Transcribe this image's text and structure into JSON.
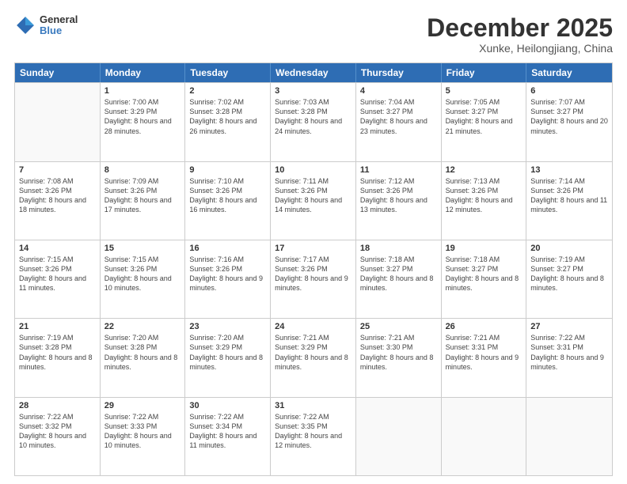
{
  "header": {
    "logo_general": "General",
    "logo_blue": "Blue",
    "month": "December 2025",
    "location": "Xunke, Heilongjiang, China"
  },
  "days_of_week": [
    "Sunday",
    "Monday",
    "Tuesday",
    "Wednesday",
    "Thursday",
    "Friday",
    "Saturday"
  ],
  "weeks": [
    [
      {
        "day": null
      },
      {
        "day": 1,
        "sunrise": "7:00 AM",
        "sunset": "3:29 PM",
        "daylight": "8 hours and 28 minutes."
      },
      {
        "day": 2,
        "sunrise": "7:02 AM",
        "sunset": "3:28 PM",
        "daylight": "8 hours and 26 minutes."
      },
      {
        "day": 3,
        "sunrise": "7:03 AM",
        "sunset": "3:28 PM",
        "daylight": "8 hours and 24 minutes."
      },
      {
        "day": 4,
        "sunrise": "7:04 AM",
        "sunset": "3:27 PM",
        "daylight": "8 hours and 23 minutes."
      },
      {
        "day": 5,
        "sunrise": "7:05 AM",
        "sunset": "3:27 PM",
        "daylight": "8 hours and 21 minutes."
      },
      {
        "day": 6,
        "sunrise": "7:07 AM",
        "sunset": "3:27 PM",
        "daylight": "8 hours and 20 minutes."
      }
    ],
    [
      {
        "day": 7,
        "sunrise": "7:08 AM",
        "sunset": "3:26 PM",
        "daylight": "8 hours and 18 minutes."
      },
      {
        "day": 8,
        "sunrise": "7:09 AM",
        "sunset": "3:26 PM",
        "daylight": "8 hours and 17 minutes."
      },
      {
        "day": 9,
        "sunrise": "7:10 AM",
        "sunset": "3:26 PM",
        "daylight": "8 hours and 16 minutes."
      },
      {
        "day": 10,
        "sunrise": "7:11 AM",
        "sunset": "3:26 PM",
        "daylight": "8 hours and 14 minutes."
      },
      {
        "day": 11,
        "sunrise": "7:12 AM",
        "sunset": "3:26 PM",
        "daylight": "8 hours and 13 minutes."
      },
      {
        "day": 12,
        "sunrise": "7:13 AM",
        "sunset": "3:26 PM",
        "daylight": "8 hours and 12 minutes."
      },
      {
        "day": 13,
        "sunrise": "7:14 AM",
        "sunset": "3:26 PM",
        "daylight": "8 hours and 11 minutes."
      }
    ],
    [
      {
        "day": 14,
        "sunrise": "7:15 AM",
        "sunset": "3:26 PM",
        "daylight": "8 hours and 11 minutes."
      },
      {
        "day": 15,
        "sunrise": "7:15 AM",
        "sunset": "3:26 PM",
        "daylight": "8 hours and 10 minutes."
      },
      {
        "day": 16,
        "sunrise": "7:16 AM",
        "sunset": "3:26 PM",
        "daylight": "8 hours and 9 minutes."
      },
      {
        "day": 17,
        "sunrise": "7:17 AM",
        "sunset": "3:26 PM",
        "daylight": "8 hours and 9 minutes."
      },
      {
        "day": 18,
        "sunrise": "7:18 AM",
        "sunset": "3:27 PM",
        "daylight": "8 hours and 8 minutes."
      },
      {
        "day": 19,
        "sunrise": "7:18 AM",
        "sunset": "3:27 PM",
        "daylight": "8 hours and 8 minutes."
      },
      {
        "day": 20,
        "sunrise": "7:19 AM",
        "sunset": "3:27 PM",
        "daylight": "8 hours and 8 minutes."
      }
    ],
    [
      {
        "day": 21,
        "sunrise": "7:19 AM",
        "sunset": "3:28 PM",
        "daylight": "8 hours and 8 minutes."
      },
      {
        "day": 22,
        "sunrise": "7:20 AM",
        "sunset": "3:28 PM",
        "daylight": "8 hours and 8 minutes."
      },
      {
        "day": 23,
        "sunrise": "7:20 AM",
        "sunset": "3:29 PM",
        "daylight": "8 hours and 8 minutes."
      },
      {
        "day": 24,
        "sunrise": "7:21 AM",
        "sunset": "3:29 PM",
        "daylight": "8 hours and 8 minutes."
      },
      {
        "day": 25,
        "sunrise": "7:21 AM",
        "sunset": "3:30 PM",
        "daylight": "8 hours and 8 minutes."
      },
      {
        "day": 26,
        "sunrise": "7:21 AM",
        "sunset": "3:31 PM",
        "daylight": "8 hours and 9 minutes."
      },
      {
        "day": 27,
        "sunrise": "7:22 AM",
        "sunset": "3:31 PM",
        "daylight": "8 hours and 9 minutes."
      }
    ],
    [
      {
        "day": 28,
        "sunrise": "7:22 AM",
        "sunset": "3:32 PM",
        "daylight": "8 hours and 10 minutes."
      },
      {
        "day": 29,
        "sunrise": "7:22 AM",
        "sunset": "3:33 PM",
        "daylight": "8 hours and 10 minutes."
      },
      {
        "day": 30,
        "sunrise": "7:22 AM",
        "sunset": "3:34 PM",
        "daylight": "8 hours and 11 minutes."
      },
      {
        "day": 31,
        "sunrise": "7:22 AM",
        "sunset": "3:35 PM",
        "daylight": "8 hours and 12 minutes."
      },
      {
        "day": null
      },
      {
        "day": null
      },
      {
        "day": null
      }
    ]
  ]
}
